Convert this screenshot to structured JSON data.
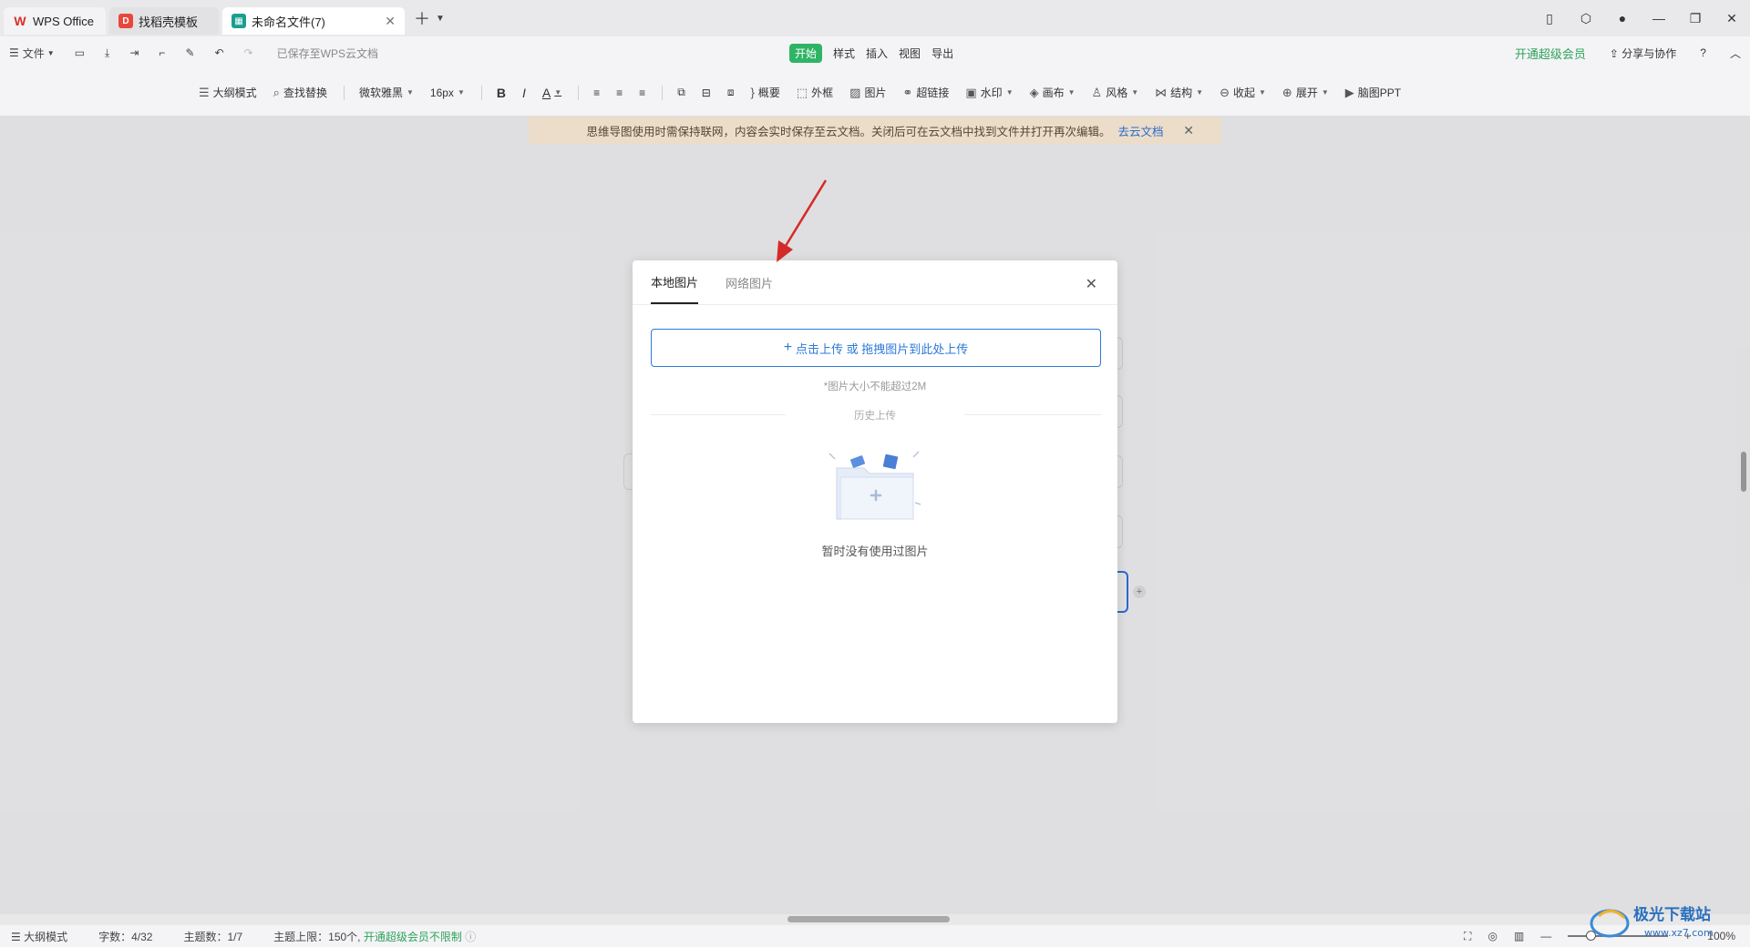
{
  "tabs": [
    {
      "label": "WPS Office"
    },
    {
      "label": "找稻壳模板"
    },
    {
      "label": "未命名文件(7)"
    }
  ],
  "menubar": {
    "file": "文件",
    "saved": "已保存至WPS云文档",
    "menus": [
      "开始",
      "样式",
      "插入",
      "视图",
      "导出"
    ],
    "vip": "开通超级会员",
    "share": "分享与协作"
  },
  "toolbar": {
    "outline": "大纲模式",
    "find": "查找替换",
    "font": "微软雅黑",
    "size": "16px",
    "summary": "概要",
    "frame": "外框",
    "image": "图片",
    "link": "超链接",
    "watermark": "水印",
    "canvas": "画布",
    "style": "风格",
    "structure": "结构",
    "collapse": "收起",
    "expand": "展开",
    "ppt": "脑图PPT"
  },
  "notice": {
    "text": "思维导图使用时需保持联网，内容会实时保存至云文档。关闭后可在云文档中找到文件并打开再次编辑。",
    "link": "去云文档"
  },
  "modal": {
    "tabs": [
      "本地图片",
      "网络图片"
    ],
    "upload": "点击上传 或 拖拽图片到此处上传",
    "size_note": "*图片大小不能超过2M",
    "history": "历史上传",
    "empty": "暂时没有使用过图片"
  },
  "status": {
    "outline": "大纲模式",
    "words": "字数：4/32",
    "topics": "主题数：1/7",
    "limit": "主题上限：150个,",
    "vip": "开通超级会员不限制",
    "zoom": "100%"
  },
  "watermark": {
    "brand": "极光下载站",
    "url": "www.xz7.com"
  },
  "colors": {
    "accent": "#2c7ad8",
    "green": "#2fb466",
    "notice_bg": "#f5e6d2",
    "arrow": "#d42a2a"
  }
}
